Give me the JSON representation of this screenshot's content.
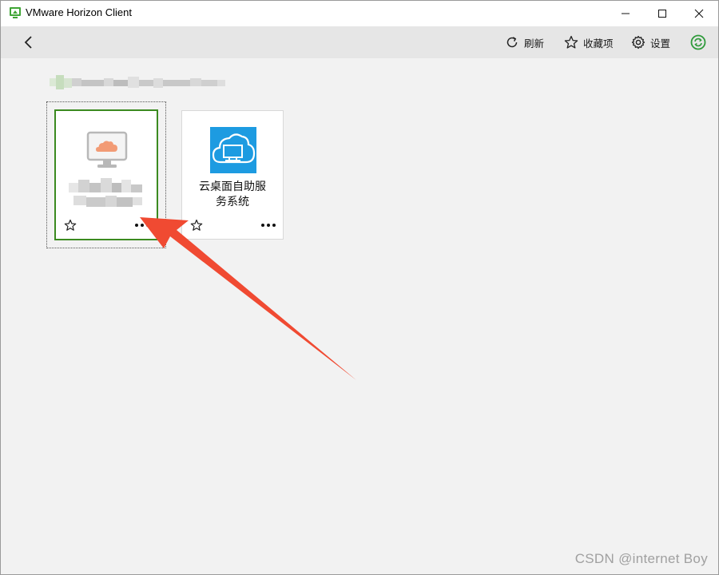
{
  "window": {
    "title": "VMware Horizon Client",
    "controls": [
      "minimize",
      "maximize",
      "close"
    ]
  },
  "toolbar": {
    "back_icon": "chevron-left-icon",
    "refresh_label": "刷新",
    "favorites_label": "收藏项",
    "settings_label": "设置",
    "sync_icon": "sync-status-icon"
  },
  "server": {
    "name_redacted": true
  },
  "tiles": [
    {
      "kind": "desktop",
      "label_redacted": true,
      "icon": "monitor-cloud-icon",
      "selected": true,
      "favorite": false,
      "menu_icon": "more-icon"
    },
    {
      "kind": "application",
      "label": "云桌面自助服务系统",
      "label_line1": "云桌面自助服",
      "label_line2": "务系统",
      "icon": "cloud-desktop-app-icon",
      "selected": false,
      "favorite": false,
      "menu_icon": "more-icon"
    }
  ],
  "annotation": {
    "arrow_color": "#f04a32",
    "points_to": "desktop tile more menu"
  },
  "watermark": "CSDN @internet  Boy",
  "colors": {
    "accent_green": "#3b8a20",
    "app_icon_blue": "#1d9be1",
    "toolbar_bg": "#e6e6e6",
    "content_bg": "#f2f2f2"
  }
}
